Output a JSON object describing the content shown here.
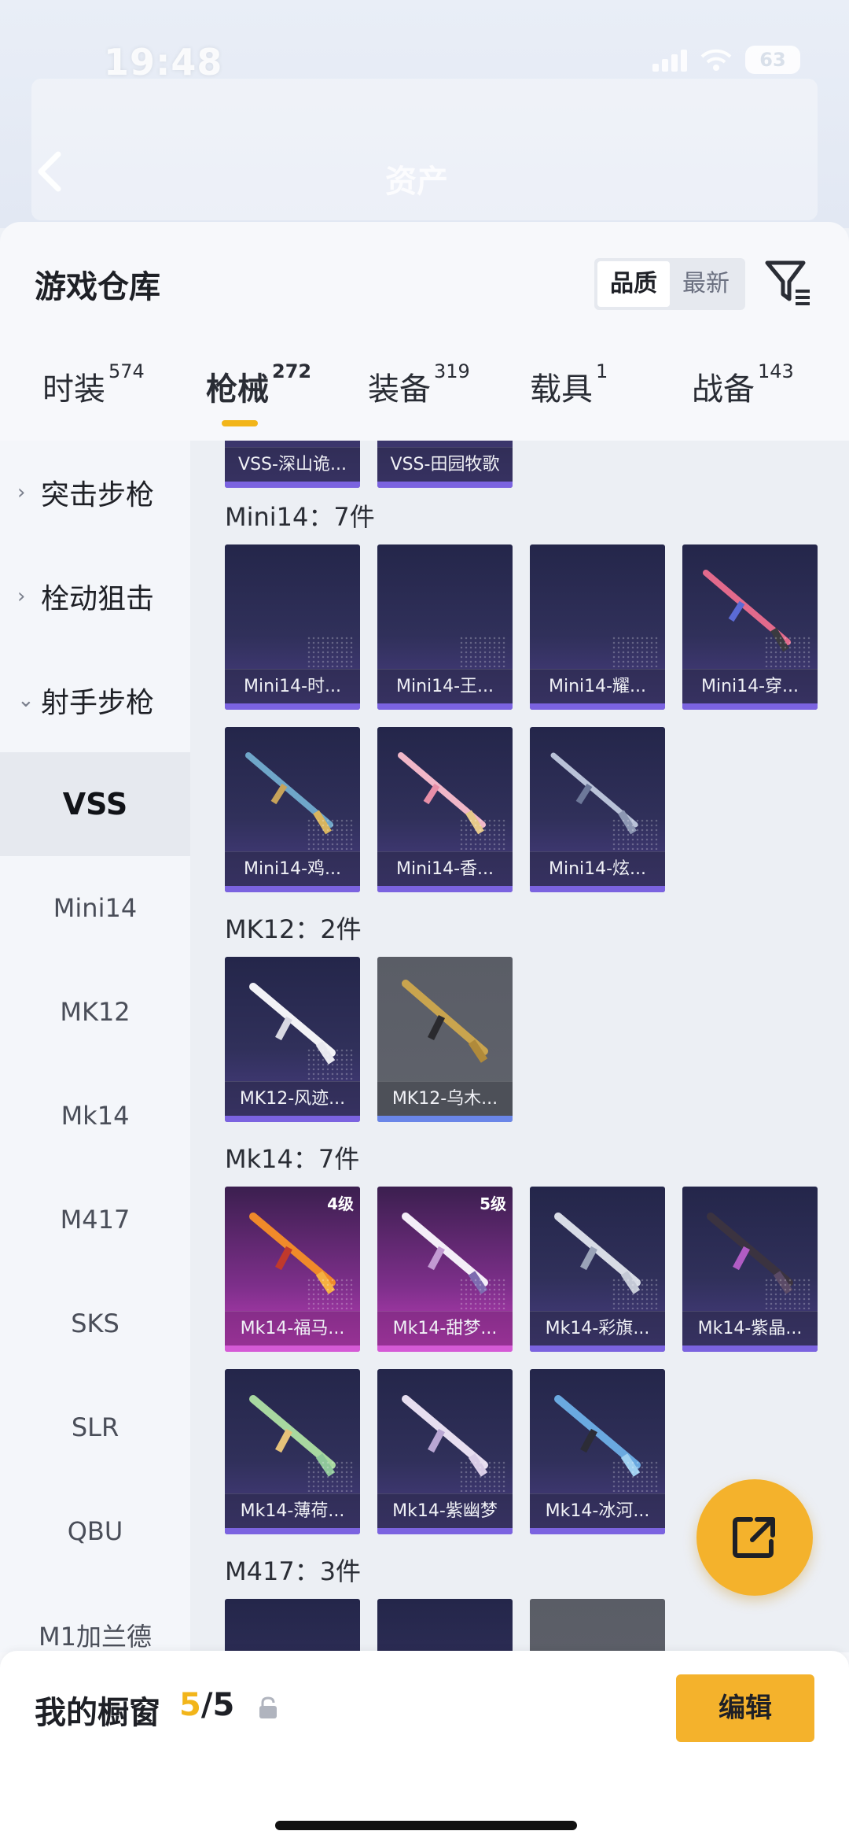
{
  "status": {
    "time": "19:48",
    "battery": "63"
  },
  "header": {
    "title": "资产"
  },
  "sheet": {
    "title": "游戏仓库"
  },
  "sort": {
    "quality": "品质",
    "latest": "最新"
  },
  "tabs": [
    {
      "label": "时装",
      "count": "574"
    },
    {
      "label": "枪械",
      "count": "272"
    },
    {
      "label": "装备",
      "count": "319"
    },
    {
      "label": "载具",
      "count": "1"
    },
    {
      "label": "战备",
      "count": "143"
    }
  ],
  "categories": [
    {
      "label": "突击步枪",
      "chevron": "›"
    },
    {
      "label": "栓动狙击",
      "chevron": "›"
    },
    {
      "label": "射手步枪",
      "chevron": "⌄"
    }
  ],
  "subcategories": [
    "VSS",
    "Mini14",
    "MK12",
    "Mk14",
    "M417",
    "SKS",
    "SLR",
    "QBU",
    "M1加兰德"
  ],
  "groups": {
    "vss_partial": [
      "VSS-深山诡...",
      "VSS-田园牧歌"
    ],
    "mini14": {
      "title": "Mini14：7件",
      "items": [
        "Mini14-时...",
        "Mini14-王...",
        "Mini14-耀...",
        "Mini14-穿...",
        "Mini14-鸡...",
        "Mini14-香...",
        "Mini14-炫..."
      ]
    },
    "mk12": {
      "title": "MK12：2件",
      "items": [
        "MK12-风迹...",
        "MK12-乌木..."
      ]
    },
    "mk14": {
      "title": "Mk14：7件",
      "items": [
        "Mk14-福马...",
        "Mk14-甜梦...",
        "Mk14-彩旗...",
        "Mk14-紫晶...",
        "Mk14-薄荷...",
        "Mk14-紫幽梦",
        "Mk14-冰河..."
      ],
      "levels": [
        "4级",
        "5级"
      ]
    },
    "m417": {
      "title": "M417：3件"
    }
  },
  "showcase": {
    "label": "我的橱窗",
    "current": "5",
    "total": "/5"
  },
  "edit_label": "编辑"
}
